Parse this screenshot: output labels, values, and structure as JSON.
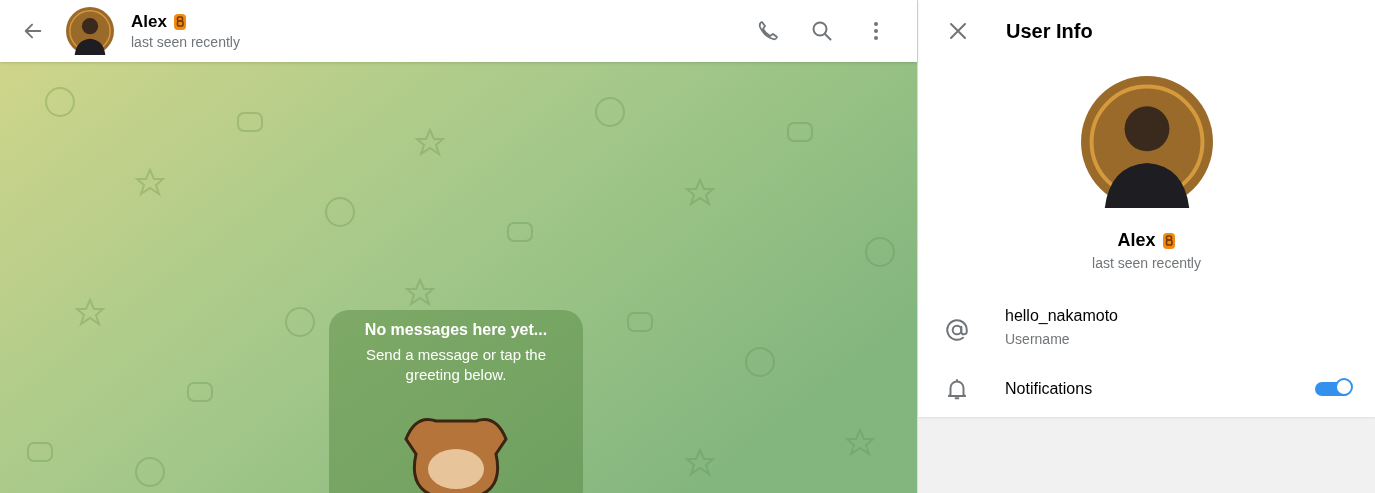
{
  "chat_header": {
    "name": "Alex",
    "status": "last seen recently"
  },
  "empty_state": {
    "title": "No messages here yet...",
    "text": "Send a message or tap the greeting below."
  },
  "user_info": {
    "title": "User Info",
    "name": "Alex",
    "status": "last seen recently",
    "rows": [
      {
        "kind": "info",
        "value": "hello_nakamoto",
        "label": "Username"
      },
      {
        "kind": "toggle",
        "label": "Notifications",
        "on": true
      }
    ]
  }
}
